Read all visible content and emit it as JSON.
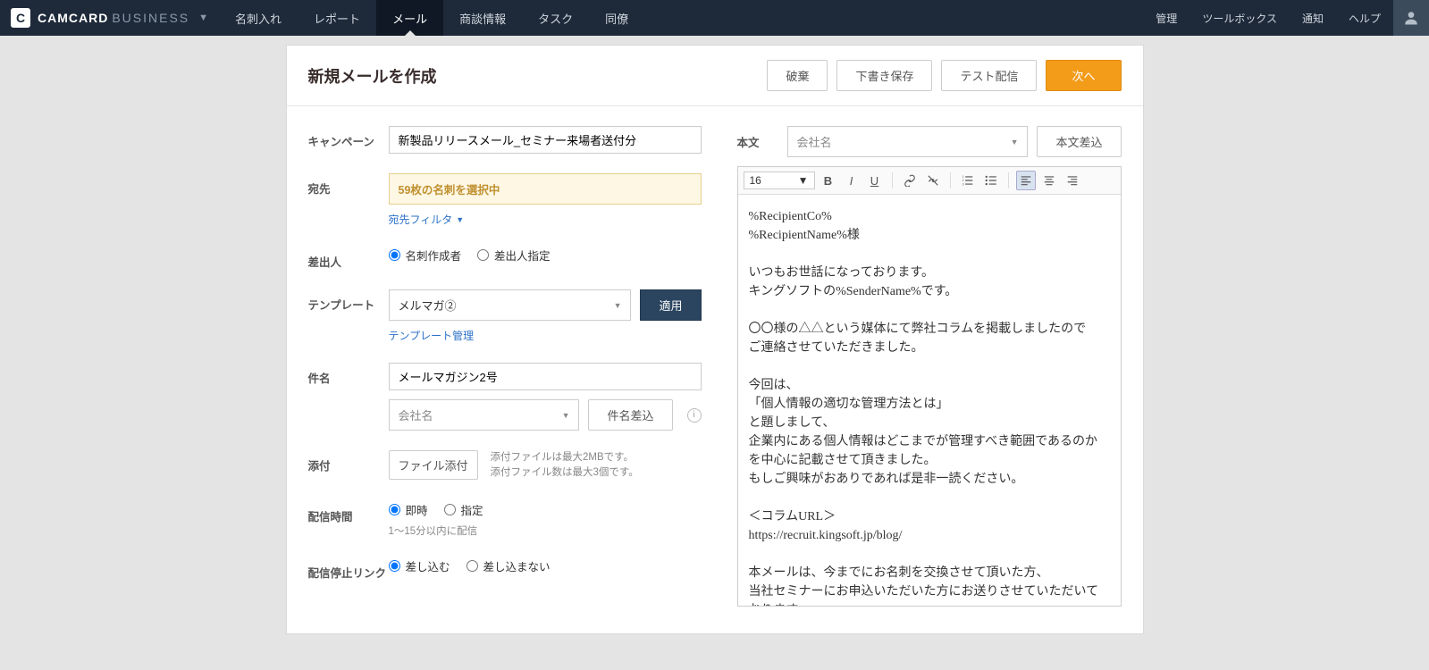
{
  "brand": {
    "mark": "C",
    "name": "CAMCARD",
    "suffix": "BUSINESS"
  },
  "nav": {
    "items": [
      "名刺入れ",
      "レポート",
      "メール",
      "商談情報",
      "タスク",
      "同僚"
    ],
    "active_index": 2,
    "right": [
      "管理",
      "ツールボックス",
      "通知",
      "ヘルプ"
    ]
  },
  "page": {
    "title": "新規メールを作成",
    "buttons": {
      "discard": "破棄",
      "draft": "下書き保存",
      "test": "テスト配信",
      "next": "次へ"
    }
  },
  "form": {
    "campaign": {
      "label": "キャンペーン",
      "value": "新製品リリースメール_セミナー来場者送付分"
    },
    "recipient": {
      "label": "宛先",
      "summary": "59枚の名刺を選択中",
      "filter_link": "宛先フィルタ"
    },
    "sender": {
      "label": "差出人",
      "opt1": "名刺作成者",
      "opt2": "差出人指定"
    },
    "template": {
      "label": "テンプレート",
      "value": "メルマガ②",
      "apply": "適用",
      "manage_link": "テンプレート管理"
    },
    "subject": {
      "label": "件名",
      "value": "メールマガジン2号",
      "merge_select": "会社名",
      "merge_btn": "件名差込"
    },
    "attach": {
      "label": "添付",
      "btn": "ファイル添付",
      "note1": "添付ファイルは最大2MBです。",
      "note2": "添付ファイル数は最大3個です。"
    },
    "send_time": {
      "label": "配信時間",
      "opt1": "即時",
      "opt2": "指定",
      "note": "1〜15分以内に配信"
    },
    "unsubscribe": {
      "label": "配信停止リンク",
      "opt1": "差し込む",
      "opt2": "差し込まない"
    }
  },
  "body_panel": {
    "label": "本文",
    "merge_select": "会社名",
    "merge_btn": "本文差込",
    "font_size": "16",
    "content_lines": [
      "%RecipientCo%",
      "%RecipientName%様",
      "",
      "いつもお世話になっております。",
      "キングソフトの%SenderName%です。",
      "",
      "〇〇様の△△という媒体にて弊社コラムを掲載しましたので",
      "ご連絡させていただきました。",
      "",
      "今回は、",
      "「個人情報の適切な管理方法とは」",
      "と題しまして、",
      "企業内にある個人情報はどこまでが管理すべき範囲であるのかを中心に記載させて頂きました。",
      "もしご興味がおありであれば是非一読ください。",
      "",
      "＜コラムURL＞",
      "https://recruit.kingsoft.jp/blog/",
      "",
      "本メールは、今までにお名刺を交換させて頂いた方、",
      "当社セミナーにお申込いただいた方にお送りさせていただいております。"
    ]
  }
}
